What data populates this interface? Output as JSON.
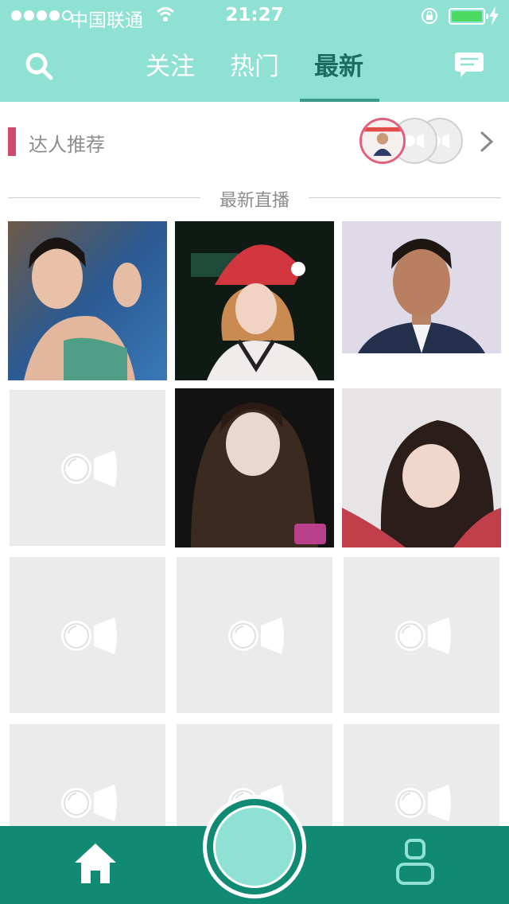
{
  "status_bar": {
    "carrier": "中国联通",
    "time": "21:27"
  },
  "colors": {
    "header": "#8ee1d3",
    "bottom_bar": "#118a73",
    "active_tab": "#1d6c60",
    "accent_bar": "#cf4b6d",
    "battery": "#4cd964",
    "placeholder": "#ebebeb"
  },
  "header": {
    "tabs": [
      {
        "label": "关注"
      },
      {
        "label": "热门"
      },
      {
        "label": "最新"
      }
    ],
    "active_tab": "最新",
    "search_icon": "search-icon",
    "message_icon": "message-icon"
  },
  "recommend": {
    "label": "达人推荐",
    "arrow_icon": "chevron-right-icon"
  },
  "section": {
    "title": "最新直播"
  },
  "grid": {
    "items": [
      {
        "type": "photo"
      },
      {
        "type": "photo"
      },
      {
        "type": "photo"
      },
      {
        "type": "placeholder",
        "icon": "camera-placeholder-icon"
      },
      {
        "type": "photo"
      },
      {
        "type": "photo"
      },
      {
        "type": "placeholder",
        "icon": "camera-placeholder-icon"
      },
      {
        "type": "placeholder",
        "icon": "camera-placeholder-icon"
      },
      {
        "type": "placeholder",
        "icon": "camera-placeholder-icon"
      },
      {
        "type": "placeholder",
        "icon": "camera-placeholder-icon"
      },
      {
        "type": "placeholder",
        "icon": "camera-placeholder-icon"
      },
      {
        "type": "placeholder",
        "icon": "camera-placeholder-icon"
      }
    ]
  },
  "bottom_nav": {
    "home_icon": "home-icon",
    "live_icon": "go-live-icon",
    "profile_icon": "user-icon"
  }
}
